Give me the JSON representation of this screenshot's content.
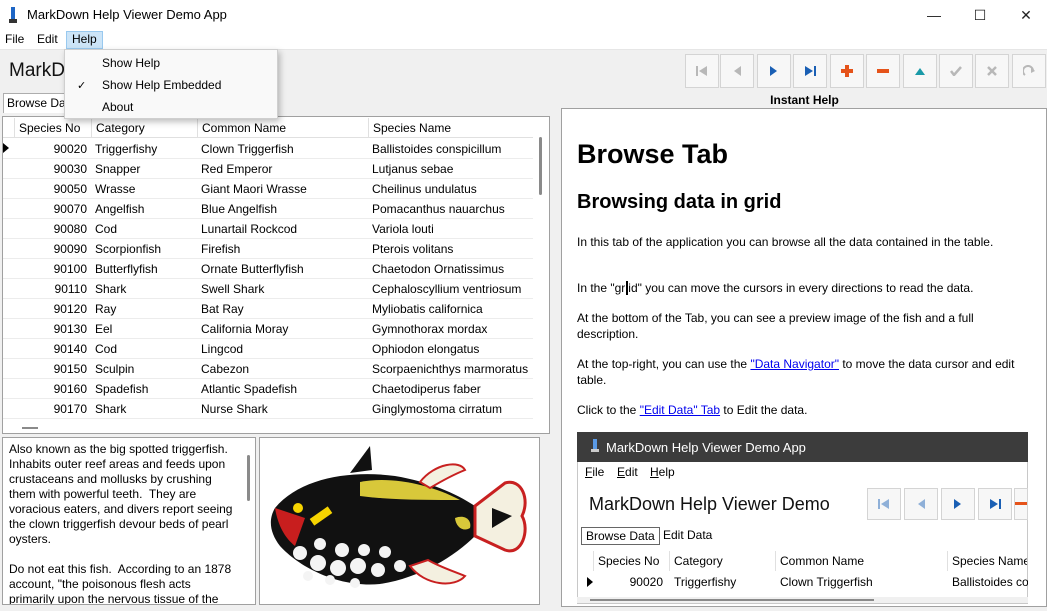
{
  "window": {
    "title": "MarkDown Help Viewer Demo App",
    "minimize": "—",
    "maximize": "☐",
    "close": "✕"
  },
  "menu": {
    "file": "File",
    "edit": "Edit",
    "help": "Help"
  },
  "help_menu": {
    "items": [
      "Show Help",
      "Show Help Embedded",
      "About"
    ],
    "checked": "✓"
  },
  "header": {
    "title_visible": "MarkDo"
  },
  "toolbar": {
    "icons": [
      "first-record-icon",
      "prior-record-icon",
      "next-record-icon",
      "last-record-icon",
      "insert-record-icon",
      "delete-record-icon",
      "edit-record-icon",
      "post-icon",
      "cancel-icon",
      "refresh-icon"
    ],
    "colors": {
      "disabled": "#b8b8b8",
      "blue": "#1a5fb4",
      "orange": "#e5531a",
      "teal": "#1a9aa8"
    }
  },
  "tab": {
    "browse_label": "Browse Dat"
  },
  "grid": {
    "columns": [
      "Species No",
      "Category",
      "Common Name",
      "Species Name"
    ],
    "rows": [
      [
        "90020",
        "Triggerfishy",
        "Clown Triggerfish",
        "Ballistoides conspicillum"
      ],
      [
        "90030",
        "Snapper",
        "Red Emperor",
        "Lutjanus sebae"
      ],
      [
        "90050",
        "Wrasse",
        "Giant Maori Wrasse",
        "Cheilinus undulatus"
      ],
      [
        "90070",
        "Angelfish",
        "Blue Angelfish",
        "Pomacanthus nauarchus"
      ],
      [
        "90080",
        "Cod",
        "Lunartail Rockcod",
        "Variola louti"
      ],
      [
        "90090",
        "Scorpionfish",
        "Firefish",
        "Pterois volitans"
      ],
      [
        "90100",
        "Butterflyfish",
        "Ornate Butterflyfish",
        "Chaetodon Ornatissimus"
      ],
      [
        "90110",
        "Shark",
        "Swell Shark",
        "Cephaloscyllium ventriosum"
      ],
      [
        "90120",
        "Ray",
        "Bat Ray",
        "Myliobatis californica"
      ],
      [
        "90130",
        "Eel",
        "California Moray",
        "Gymnothorax mordax"
      ],
      [
        "90140",
        "Cod",
        "Lingcod",
        "Ophiodon elongatus"
      ],
      [
        "90150",
        "Sculpin",
        "Cabezon",
        "Scorpaenichthys marmoratus"
      ],
      [
        "90160",
        "Spadefish",
        "Atlantic Spadefish",
        "Chaetodiperus faber"
      ],
      [
        "90170",
        "Shark",
        "Nurse Shark",
        "Ginglymostoma cirratum"
      ]
    ]
  },
  "description": "Also known as the big spotted triggerfish.  Inhabits outer reef areas and feeds upon crustaceans and mollusks by crushing them with powerful teeth.  They are voracious eaters, and divers report seeing the clown triggerfish devour beds of pearl oysters.\n\nDo not eat this fish.  According to an 1878 account, \"the poisonous flesh acts primarily upon the nervous tissue of the",
  "help": {
    "panel_title": "Instant Help",
    "h1": "Browse Tab",
    "h2": "Browsing data in grid",
    "p1": "In this tab of the application you can browse all the data contained in the table.",
    "p2_a": "In the \"gr",
    "p2_b": "id\" you can move the cursors in every directions to read the data.",
    "p3": "At the bottom of the Tab, you can see a preview image of the fish and a full description.",
    "p4_a": "At the top-right, you can use the ",
    "p4_link": "\"Data Navigator\"",
    "p4_b": " to move the data cursor and edit table.",
    "p5_a": "Click to the ",
    "p5_link": "\"Edit Data\" Tab",
    "p5_b": " to Edit the data."
  },
  "embedded": {
    "title": "MarkDown Help Viewer Demo App",
    "menu": [
      "File",
      "Edit",
      "Help"
    ],
    "heading": "MarkDown Help Viewer Demo",
    "tabs": [
      "Browse Data",
      "Edit Data"
    ],
    "columns": [
      "Species No",
      "Category",
      "Common Name",
      "Species Name"
    ],
    "row": [
      "90020",
      "Triggerfishy",
      "Clown Triggerfish",
      "Ballistoides co"
    ]
  }
}
